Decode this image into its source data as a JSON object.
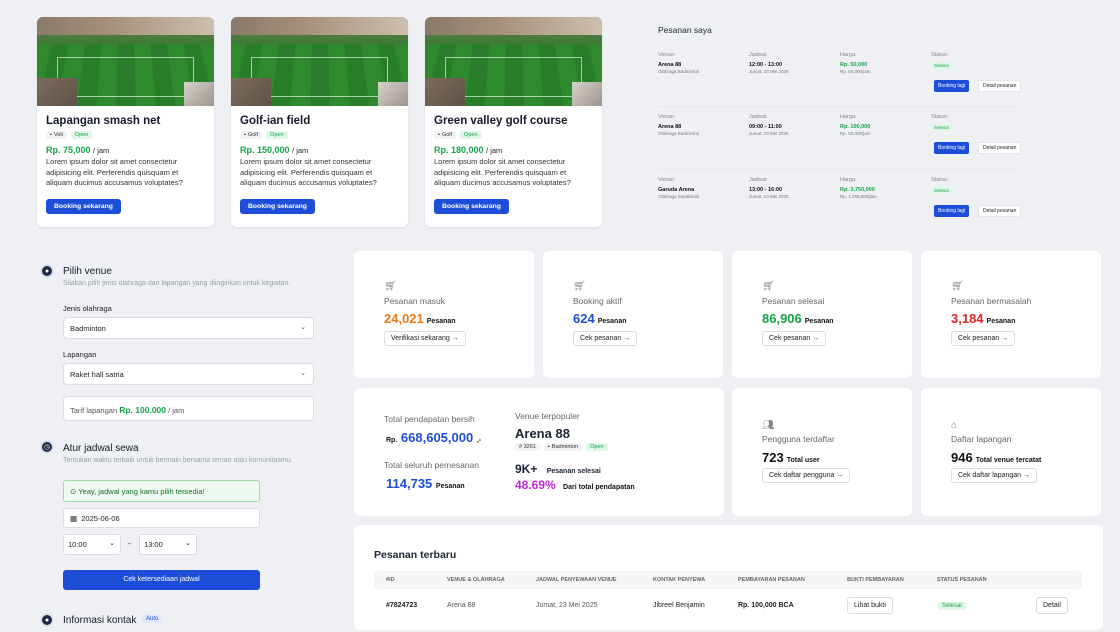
{
  "venues": [
    {
      "name": "Lapangan smash net",
      "sport": "Voli",
      "status": "Open",
      "price": "Rp. 75,000",
      "unit": "/ jam",
      "desc": "Lorem ipsum dolor sit amet consectetur adipisicing elit. Perferendis quisquam et aliquam ducimus accusamus voluptates?",
      "button": "Booking sekarang"
    },
    {
      "name": "Golf-ian field",
      "sport": "Golf",
      "status": "Open",
      "price": "Rp. 150,000",
      "unit": "/ jam",
      "desc": "Lorem ipsum dolor sit amet consectetur adipisicing elit. Perferendis quisquam et aliquam ducimus accusamus voluptates?",
      "button": "Booking sekarang"
    },
    {
      "name": "Green valley golf course",
      "sport": "Golf",
      "status": "Open",
      "price": "Rp. 180,000",
      "unit": "/ jam",
      "desc": "Lorem ipsum dolor sit amet consectetur adipisicing elit. Perferendis quisquam et aliquam ducimus accusamus voluptates?",
      "button": "Booking sekarang"
    }
  ],
  "my_orders": {
    "title": "Pesanan saya",
    "labels": {
      "venue": "Venue:",
      "jadwal": "Jadwal:",
      "harga": "Harga:",
      "status": "Status:"
    },
    "rows": [
      {
        "venue": "Arena 88",
        "venue_sub": "Olahraga Badminton",
        "time": "12:00 - 13:00",
        "date": "Jumat, 23 Mei 2025",
        "price": "Rp. 50,000",
        "price_sub": "Rp. 50,000/jam",
        "status": "Selesai",
        "btn1": "Booking lagi",
        "btn2": "Detail pesanan"
      },
      {
        "venue": "Arena 88",
        "venue_sub": "Olahraga Badminton",
        "time": "09:00 - 11:00",
        "date": "Jumat, 23 Mei 2025",
        "price": "Rp. 100,000",
        "price_sub": "Rp. 50,000/jam",
        "status": "Selesai",
        "btn1": "Booking lagi",
        "btn2": "Detail pesanan"
      },
      {
        "venue": "Garuda Arena",
        "venue_sub": "Olahraga Sepakbola",
        "time": "13:00 - 16:00",
        "date": "Jumat, 23 Mei 2025",
        "price": "Rp. 3,750,000",
        "price_sub": "Rp. 1,250,000/jam",
        "status": "Selesai",
        "btn1": "Booking lagi",
        "btn2": "Detail pesanan"
      }
    ]
  },
  "form": {
    "step1_title": "Pilih venue",
    "step1_sub": "Silakan pilih jenis olahraga dan lapangan yang diinginkan untuk kegiatan.",
    "sport_label": "Jenis olahraga",
    "sport_value": "Badminton",
    "field_label": "Lapangan",
    "field_value": "Raket hall satria",
    "tarif_prefix": "Tarif lapangan",
    "tarif_value": "Rp. 100.000",
    "tarif_unit": "/ jam",
    "step2_title": "Atur jadwal sewa",
    "step2_sub": "Tentukan waktu terbaik untuk bermain bersama teman atau komunitasmu.",
    "ok_msg": "Yeay, jadwal yang kamu pilih tersedia!",
    "date": "2025-06-06",
    "start": "10:00",
    "dash": "-",
    "end": "13:00",
    "check_btn": "Cek ketersediaan jadwal",
    "step3_title": "Informasi kontak",
    "step3_badge": "Auto"
  },
  "stats": [
    {
      "label": "Pesanan masuk",
      "value": "24,021",
      "unit": "Pesanan",
      "btn": "Verifikasi sekarang →",
      "color": "#ea7a12"
    },
    {
      "label": "Booking aktif",
      "value": "624",
      "unit": "Pesanan",
      "btn": "Cek pesanan →",
      "color": "#1d4ed8"
    },
    {
      "label": "Pesanan selesai",
      "value": "86,906",
      "unit": "Pesanan",
      "btn": "Cek pesanan →",
      "color": "#16a34a"
    },
    {
      "label": "Pesanan bermasalah",
      "value": "3,184",
      "unit": "Pesanan",
      "btn": "Cek pesanan →",
      "color": "#dc2626"
    }
  ],
  "totals": {
    "income_label": "Total pendapatan bersih",
    "income_prefix": "Rp.",
    "income_value": "668,605,000",
    "income_suffix": ",-",
    "orders_label": "Total seluruh pemesanan",
    "orders_value": "114,735",
    "orders_unit": "Pesanan",
    "popular_label": "Venue terpopuler",
    "popular_name": "Arena 88",
    "popular_id": "# 3261",
    "popular_sport": "Badminton",
    "popular_status": "Open",
    "popular_count": "9K+",
    "popular_count_label": "Pesanan selesai",
    "popular_pct": "48.69%",
    "popular_pct_label": "Dari total pendapatan"
  },
  "users": {
    "label": "Pengguna terdaftar",
    "value": "723",
    "unit": "Total user",
    "btn": "Cek daftar pengguna →"
  },
  "courts": {
    "label": "Daftar lapangan",
    "value": "946",
    "unit": "Total venue tercatat",
    "btn": "Cek daftar lapangan →"
  },
  "recent": {
    "title": "Pesanan terbaru",
    "headers": [
      "#ID",
      "VENUE & OLAHRAGA",
      "JADWAL PENYEWAAN VENUE",
      "KONTAK PENYEWA",
      "PEMBAYARAN PESANAN",
      "BUKTI PEMBAYARAN",
      "STATUS PESANAN"
    ],
    "row": {
      "id": "#7824723",
      "venue": "Arena 88",
      "date": "Jumat, 23 Mei 2025",
      "contact": "Jibreel Benjamin",
      "payment": "Rp. 100,000 BCA",
      "proof": "Lihat bukti",
      "status": "Selesai",
      "detail": "Detail"
    }
  }
}
